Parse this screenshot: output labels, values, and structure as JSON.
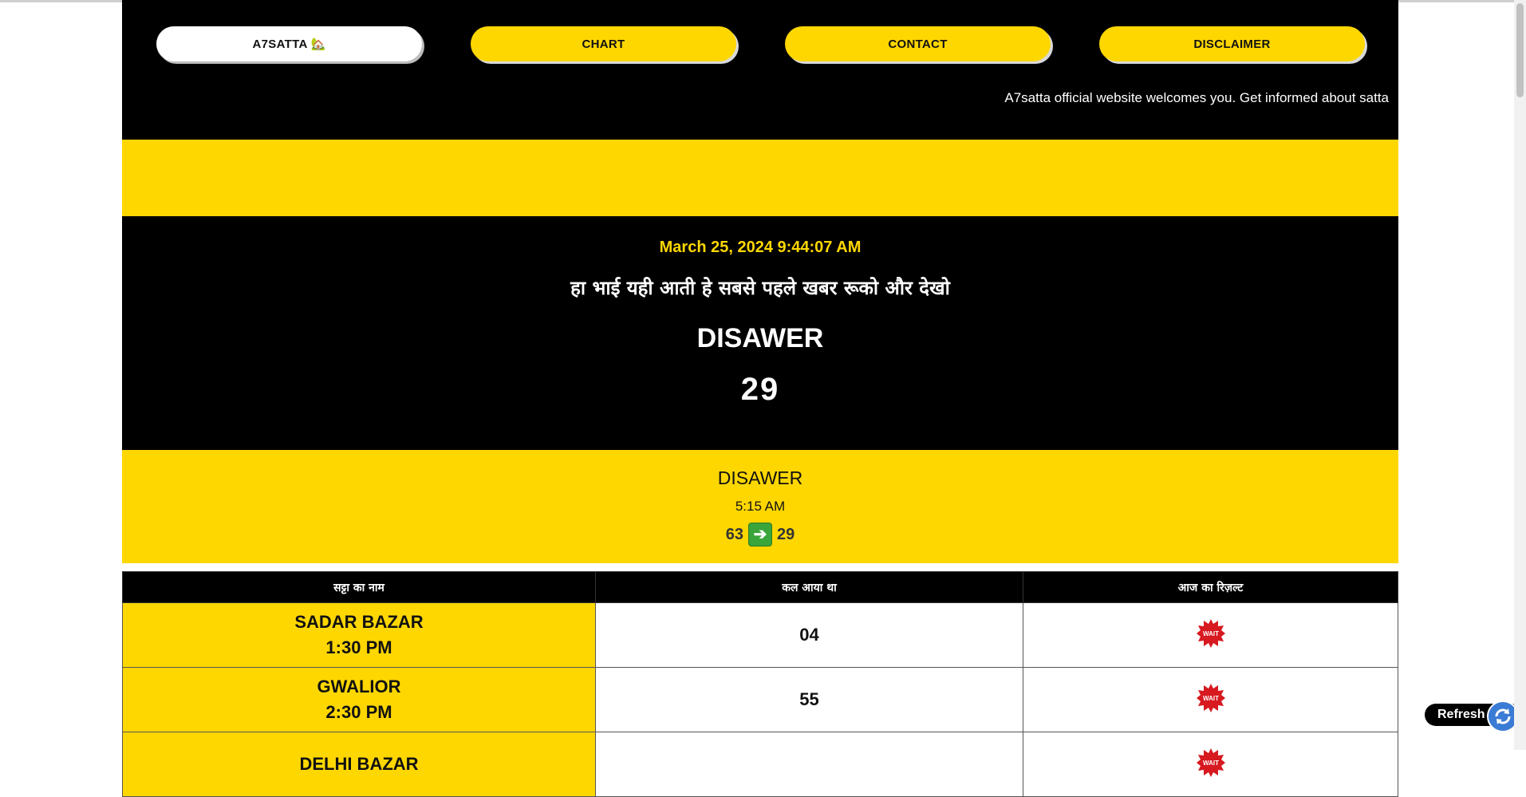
{
  "nav": {
    "items": [
      {
        "label": "A7SATTA 🏡"
      },
      {
        "label": "CHART"
      },
      {
        "label": "CONTACT"
      },
      {
        "label": "DISCLAIMER"
      }
    ]
  },
  "marquee": {
    "text": "A7satta official website welcomes you. Get informed about satta"
  },
  "live": {
    "datetime": "March 25, 2024 9:44:07 AM",
    "hindi_text": "हा भाई यही आती हे सबसे पहले खबर रूको और देखो",
    "game": "DISAWER",
    "number": "29"
  },
  "next": {
    "game": "DISAWER",
    "time": "5:15 AM",
    "previous": "63",
    "current": "29"
  },
  "table": {
    "headers": [
      "सट्टा का नाम",
      "कल आया था",
      "आज का रिज़ल्ट"
    ],
    "rows": [
      {
        "name": "SADAR BAZAR",
        "time": "1:30 PM",
        "yesterday": "04",
        "today": "WAIT"
      },
      {
        "name": "GWALIOR",
        "time": "2:30 PM",
        "yesterday": "55",
        "today": "WAIT"
      },
      {
        "name": "DELHI BAZAR",
        "time": "",
        "yesterday": "",
        "today": "WAIT"
      }
    ]
  },
  "refresh": {
    "label": "Refresh"
  },
  "colors": {
    "accent": "#ffd700",
    "background": "#000000"
  }
}
